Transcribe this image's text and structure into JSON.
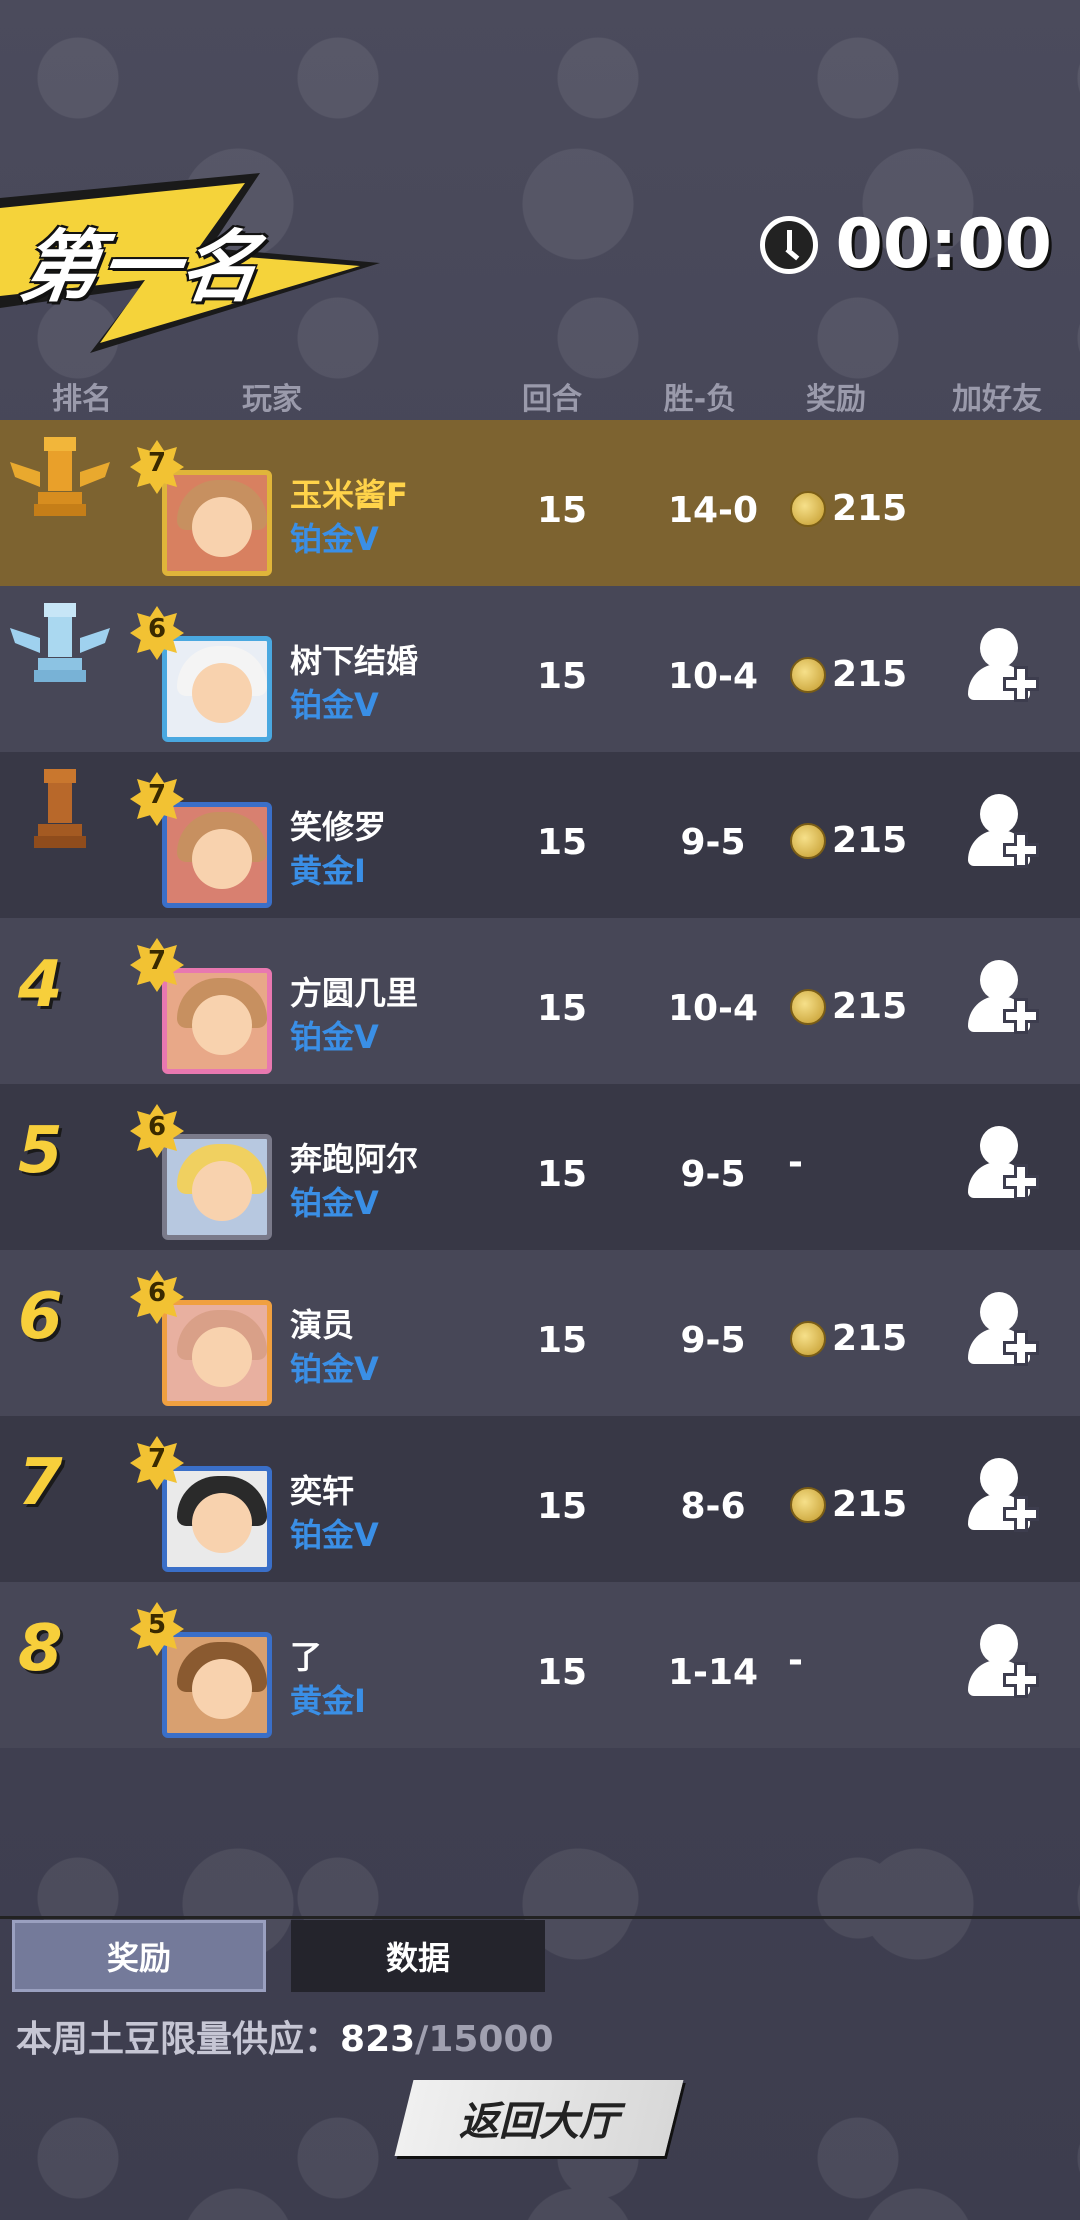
{
  "title": "第一名",
  "timer": "00:00",
  "headers": {
    "rank": "排名",
    "player": "玩家",
    "rounds": "回合",
    "win_loss": "胜-负",
    "reward": "奖励",
    "add_friend": "加好友"
  },
  "rows": [
    {
      "rank": "1",
      "level": "7",
      "name": "玉米酱F",
      "tier": "铂金V",
      "rounds": "15",
      "win_loss": "14-0",
      "reward": "215"
    },
    {
      "rank": "2",
      "level": "6",
      "name": "树下结婚",
      "tier": "铂金V",
      "rounds": "15",
      "win_loss": "10-4",
      "reward": "215"
    },
    {
      "rank": "3",
      "level": "7",
      "name": "笑修罗",
      "tier": "黄金I",
      "rounds": "15",
      "win_loss": "9-5",
      "reward": "215"
    },
    {
      "rank": "4",
      "level": "7",
      "name": "方圆几里",
      "tier": "铂金V",
      "rounds": "15",
      "win_loss": "10-4",
      "reward": "215"
    },
    {
      "rank": "5",
      "level": "6",
      "name": "奔跑阿尔",
      "tier": "铂金V",
      "rounds": "15",
      "win_loss": "9-5",
      "reward": "-"
    },
    {
      "rank": "6",
      "level": "6",
      "name": "演员",
      "tier": "铂金V",
      "rounds": "15",
      "win_loss": "9-5",
      "reward": "215"
    },
    {
      "rank": "7",
      "level": "7",
      "name": "奕轩",
      "tier": "铂金V",
      "rounds": "15",
      "win_loss": "8-6",
      "reward": "215"
    },
    {
      "rank": "8",
      "level": "5",
      "name": "了",
      "tier": "黄金I",
      "rounds": "15",
      "win_loss": "1-14",
      "reward": "-"
    }
  ],
  "tabs": {
    "reward": "奖励",
    "data": "数据"
  },
  "supply": {
    "label": "本周土豆限量供应：",
    "current": "823",
    "max": "/15000"
  },
  "back_button": "返回大厅",
  "colors": {
    "gold_row": "#7d6330",
    "tier_blue": "#3a8fe6",
    "rank_yellow": "#f7cf3b"
  }
}
